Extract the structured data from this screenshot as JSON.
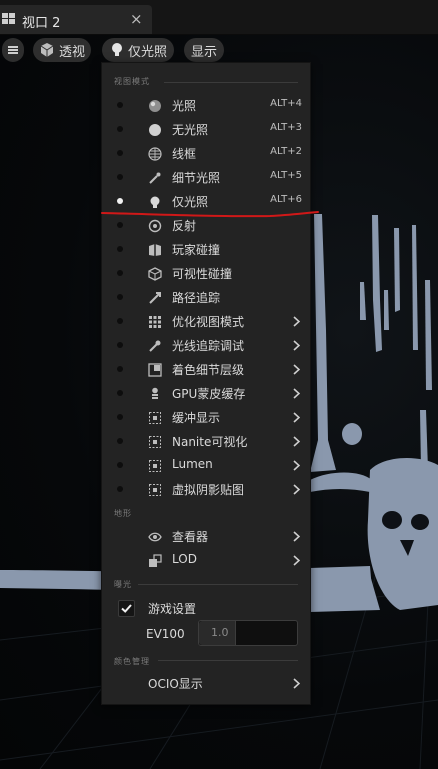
{
  "tab": {
    "title": "视口 2",
    "close": "×"
  },
  "toolbar": {
    "perspective_label": "透视",
    "view_mode_label": "仅光照",
    "show_label": "显示"
  },
  "menu": {
    "section_view_modes": "视图模式",
    "view_modes": [
      {
        "label": "光照",
        "shortcut": "ALT+4",
        "icon": "lit-sphere-icon",
        "selected": false
      },
      {
        "label": "无光照",
        "shortcut": "ALT+3",
        "icon": "unlit-sphere-icon",
        "selected": false
      },
      {
        "label": "线框",
        "shortcut": "ALT+2",
        "icon": "wireframe-sphere-icon",
        "selected": false
      },
      {
        "label": "细节光照",
        "shortcut": "ALT+5",
        "icon": "detail-lighting-icon",
        "selected": false
      },
      {
        "label": "仅光照",
        "shortcut": "ALT+6",
        "icon": "lightbulb-icon",
        "selected": true
      },
      {
        "label": "反射",
        "shortcut": "",
        "icon": "reflection-icon",
        "selected": false
      },
      {
        "label": "玩家碰撞",
        "shortcut": "",
        "icon": "player-collision-icon",
        "selected": false
      },
      {
        "label": "可视性碰撞",
        "shortcut": "",
        "icon": "visibility-collision-icon",
        "selected": false
      },
      {
        "label": "路径追踪",
        "shortcut": "",
        "icon": "path-tracing-icon",
        "selected": false
      },
      {
        "label": "优化视图模式",
        "shortcut": "",
        "icon": "optimization-grid-icon",
        "selected": false,
        "submenu": true
      },
      {
        "label": "光线追踪调试",
        "shortcut": "",
        "icon": "ray-tracing-debug-icon",
        "selected": false,
        "submenu": true
      },
      {
        "label": "着色细节层级",
        "shortcut": "",
        "icon": "shading-lod-icon",
        "selected": false,
        "submenu": true
      },
      {
        "label": "GPU蒙皮缓存",
        "shortcut": "",
        "icon": "skeleton-icon",
        "selected": false,
        "submenu": true
      },
      {
        "label": "缓冲显示",
        "shortcut": "",
        "icon": "buffer-icon",
        "selected": false,
        "submenu": true
      },
      {
        "label": "Nanite可视化",
        "shortcut": "",
        "icon": "nanite-icon",
        "selected": false,
        "submenu": true
      },
      {
        "label": "Lumen",
        "shortcut": "",
        "icon": "lumen-icon",
        "selected": false,
        "submenu": true
      },
      {
        "label": "虚拟阴影贴图",
        "shortcut": "",
        "icon": "virtual-shadow-map-icon",
        "selected": false,
        "submenu": true
      }
    ],
    "section_landscape": "地形",
    "landscape_items": [
      {
        "label": "查看器",
        "icon": "eye-icon"
      },
      {
        "label": "LOD",
        "icon": "lod-icon"
      }
    ],
    "section_exposure": "曝光",
    "game_settings_label": "游戏设置",
    "game_settings_checked": true,
    "ev100_label": "EV100",
    "ev100_value": "1.0",
    "section_color": "颜色管理",
    "ocio_label": "OCIO显示"
  },
  "colors": {
    "menu_bg": "#232323",
    "annotation_red": "#d01818",
    "mesh": "#8a98ad"
  }
}
